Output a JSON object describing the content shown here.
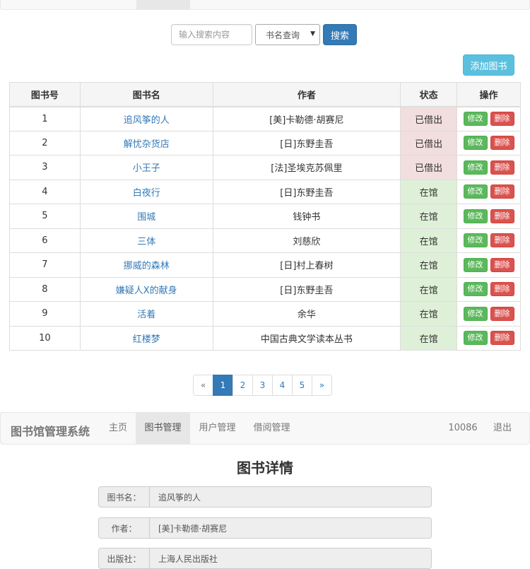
{
  "search": {
    "placeholder": "输入搜索内容",
    "select_value": "书名查询",
    "button_label": "搜索"
  },
  "add_button_label": "添加图书",
  "table": {
    "headers": [
      "图书号",
      "图书名",
      "作者",
      "状态",
      "操作"
    ],
    "edit_label": "修改",
    "delete_label": "删除",
    "rows": [
      {
        "id": "1",
        "name": "追风筝的人",
        "author": "[美]卡勒德·胡赛尼",
        "status": "已借出"
      },
      {
        "id": "2",
        "name": "解忧杂货店",
        "author": "[日]东野圭吾",
        "status": "已借出"
      },
      {
        "id": "3",
        "name": "小王子",
        "author": "[法]圣埃克苏佩里",
        "status": "已借出"
      },
      {
        "id": "4",
        "name": "白夜行",
        "author": "[日]东野圭吾",
        "status": "在馆"
      },
      {
        "id": "5",
        "name": "围城",
        "author": "钱钟书",
        "status": "在馆"
      },
      {
        "id": "6",
        "name": "三体",
        "author": "刘慈欣",
        "status": "在馆"
      },
      {
        "id": "7",
        "name": "挪威的森林",
        "author": "[日]村上春树",
        "status": "在馆"
      },
      {
        "id": "8",
        "name": "嫌疑人X的献身",
        "author": "[日]东野圭吾",
        "status": "在馆"
      },
      {
        "id": "9",
        "name": "活着",
        "author": "余华",
        "status": "在馆"
      },
      {
        "id": "10",
        "name": "红楼梦",
        "author": "中国古典文学读本丛书",
        "status": "在馆"
      }
    ]
  },
  "pagination": {
    "prev": "«",
    "pages": [
      "1",
      "2",
      "3",
      "4",
      "5"
    ],
    "next": "»",
    "active": "1"
  },
  "navbar": {
    "brand": "图书馆管理系统",
    "links": [
      "主页",
      "图书管理",
      "用户管理",
      "借阅管理"
    ],
    "active_link": "图书管理",
    "user_id": "10086",
    "logout": "退出"
  },
  "detail": {
    "title": "图书详情",
    "fields": [
      {
        "label": "图书名：",
        "value": "追风筝的人"
      },
      {
        "label": "作者：",
        "value": "[美]卡勒德·胡赛尼"
      },
      {
        "label": "出版社：",
        "value": "上海人民出版社"
      }
    ]
  },
  "colors": {
    "primary": "#337ab7",
    "info": "#5bc0de",
    "success": "#5cb85c",
    "danger": "#d9534f",
    "lent_row": "#f2dede",
    "in_row": "#dff0d8"
  }
}
